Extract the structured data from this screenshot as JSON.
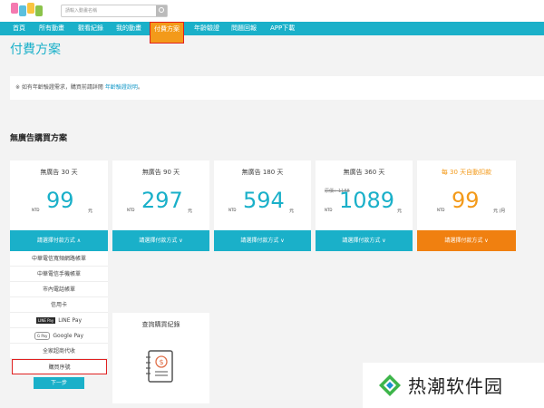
{
  "header": {
    "search_placeholder": "請輸入動畫名稱"
  },
  "nav": {
    "items": [
      {
        "label": "首頁"
      },
      {
        "label": "所有動畫"
      },
      {
        "label": "觀看紀錄"
      },
      {
        "label": "我的動畫"
      },
      {
        "label": "付費方案"
      },
      {
        "label": "年齡驗證"
      },
      {
        "label": "問題回報"
      },
      {
        "label": "APP下載"
      }
    ],
    "active_index": 4
  },
  "page": {
    "title": "付費方案",
    "notice_prefix": "※ 如有年齡驗證需求，購買前請詳閱",
    "notice_link": "年齡驗證說明",
    "notice_suffix": "。",
    "section_title": "無廣告購買方案"
  },
  "plans": [
    {
      "name": "無廣告 30 天",
      "currency": "NTD",
      "price": "99",
      "unit": "元",
      "button": "請選擇付款方式 ∧"
    },
    {
      "name": "無廣告 90 天",
      "currency": "NTD",
      "price": "297",
      "unit": "元",
      "button": "請選擇付款方式 ∨"
    },
    {
      "name": "無廣告 180 天",
      "currency": "NTD",
      "price": "594",
      "unit": "元",
      "button": "請選擇付款方式 ∨"
    },
    {
      "name": "無廣告 360 天",
      "currency": "NTD",
      "original": "原價：1188",
      "price": "1089",
      "unit": "元",
      "button": "請選擇付款方式 ∨"
    },
    {
      "name": "每 30 天自動扣款",
      "currency": "NTD",
      "price": "99",
      "unit": "元 /月",
      "button": "請選擇付款方式 ∨"
    }
  ],
  "payment_options": [
    {
      "label": "中華電信寬頻網路帳單"
    },
    {
      "label": "中華電信手機帳單"
    },
    {
      "label": "市內電話帳單"
    },
    {
      "label": "信用卡"
    },
    {
      "label": "LINE Pay",
      "tag": "LINE Pay"
    },
    {
      "label": "Google Pay",
      "tag": "G Pay"
    },
    {
      "label": "全家超商代收"
    },
    {
      "label": "購買序號"
    }
  ],
  "next_button": "下一步",
  "query": {
    "title": "查詢購買紀錄"
  },
  "watermark": {
    "text": "热潮软件园"
  },
  "colors": {
    "accent": "#1ab0c9",
    "orange": "#f08010",
    "highlight_border": "#e02020"
  }
}
